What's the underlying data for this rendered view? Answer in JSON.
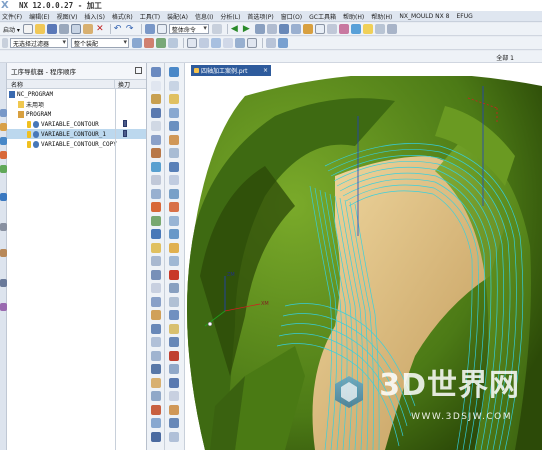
{
  "window": {
    "logo": "X",
    "title": "NX 12.0.0.27 - 加工"
  },
  "menu": [
    {
      "label": "文件(F)",
      "key": "file"
    },
    {
      "label": "编辑(E)",
      "key": "edit"
    },
    {
      "label": "视图(V)",
      "key": "view"
    },
    {
      "label": "插入(S)",
      "key": "insert"
    },
    {
      "label": "格式(R)",
      "key": "format"
    },
    {
      "label": "工具(T)",
      "key": "tools"
    },
    {
      "label": "装配(A)",
      "key": "assembly"
    },
    {
      "label": "信息(I)",
      "key": "info"
    },
    {
      "label": "分析(L)",
      "key": "analysis"
    },
    {
      "label": "首选项(P)",
      "key": "prefs"
    },
    {
      "label": "窗口(O)",
      "key": "window"
    },
    {
      "label": "GC工具箱",
      "key": "gc"
    },
    {
      "label": "帮助(H)",
      "key": "help"
    },
    {
      "label": "帮助(H)",
      "key": "help2"
    },
    {
      "label": "NX_MOULD NX 8",
      "key": "mould"
    },
    {
      "label": "EFUG",
      "key": "efug"
    }
  ],
  "toolbar1": {
    "start_label": "启动 ▾",
    "snap_combo": "整体命令",
    "icon_names": [
      "start-icon",
      "new-file-icon",
      "open-file-icon",
      "save-icon",
      "cut-icon",
      "copy-icon",
      "paste-icon",
      "delete-icon",
      "undo-icon",
      "redo-icon"
    ]
  },
  "toolbar2": {
    "filter_combo": "无选择过滤器",
    "assembly_combo": "整个装配"
  },
  "row3": {
    "full_label": "全部 1"
  },
  "navigator": {
    "title": "工序导航器 - 程序顺序",
    "columns": {
      "name": "名称",
      "tool_change": "换刀"
    },
    "rows": [
      {
        "label": "NC_PROGRAM",
        "indent": 0,
        "icon": "root",
        "selected": false,
        "tool": false
      },
      {
        "label": "未用项",
        "indent": 1,
        "icon": "folder",
        "selected": false,
        "tool": false
      },
      {
        "label": "PROGRAM",
        "indent": 1,
        "icon": "program",
        "selected": false,
        "tool": false
      },
      {
        "label": "VARIABLE_CONTOUR",
        "indent": 2,
        "icon": "operation",
        "selected": false,
        "tool": true
      },
      {
        "label": "VARIABLE_CONTOUR_1",
        "indent": 2,
        "icon": "operation",
        "selected": true,
        "tool": true
      },
      {
        "label": "VARIABLE_CONTOUR_COPY",
        "indent": 2,
        "icon": "operation",
        "selected": false,
        "tool": false
      }
    ]
  },
  "viewport": {
    "tab_label": "四轴加工案例.prt",
    "tab_close": "×",
    "axis_labels": {
      "z": "ZM",
      "y": "YM",
      "x": "XM"
    },
    "watermark": {
      "text": "3D世界网",
      "url": "WWW.3DSJW.COM"
    }
  },
  "colors": {
    "part_green": "#5a8a1c",
    "part_dark": "#2c4a08",
    "toolpath_cyan": "#34d0e0",
    "machined_tan": "#d4b878",
    "selection_blue": "#bcd8ee",
    "tab_blue": "#2e5b9c"
  }
}
